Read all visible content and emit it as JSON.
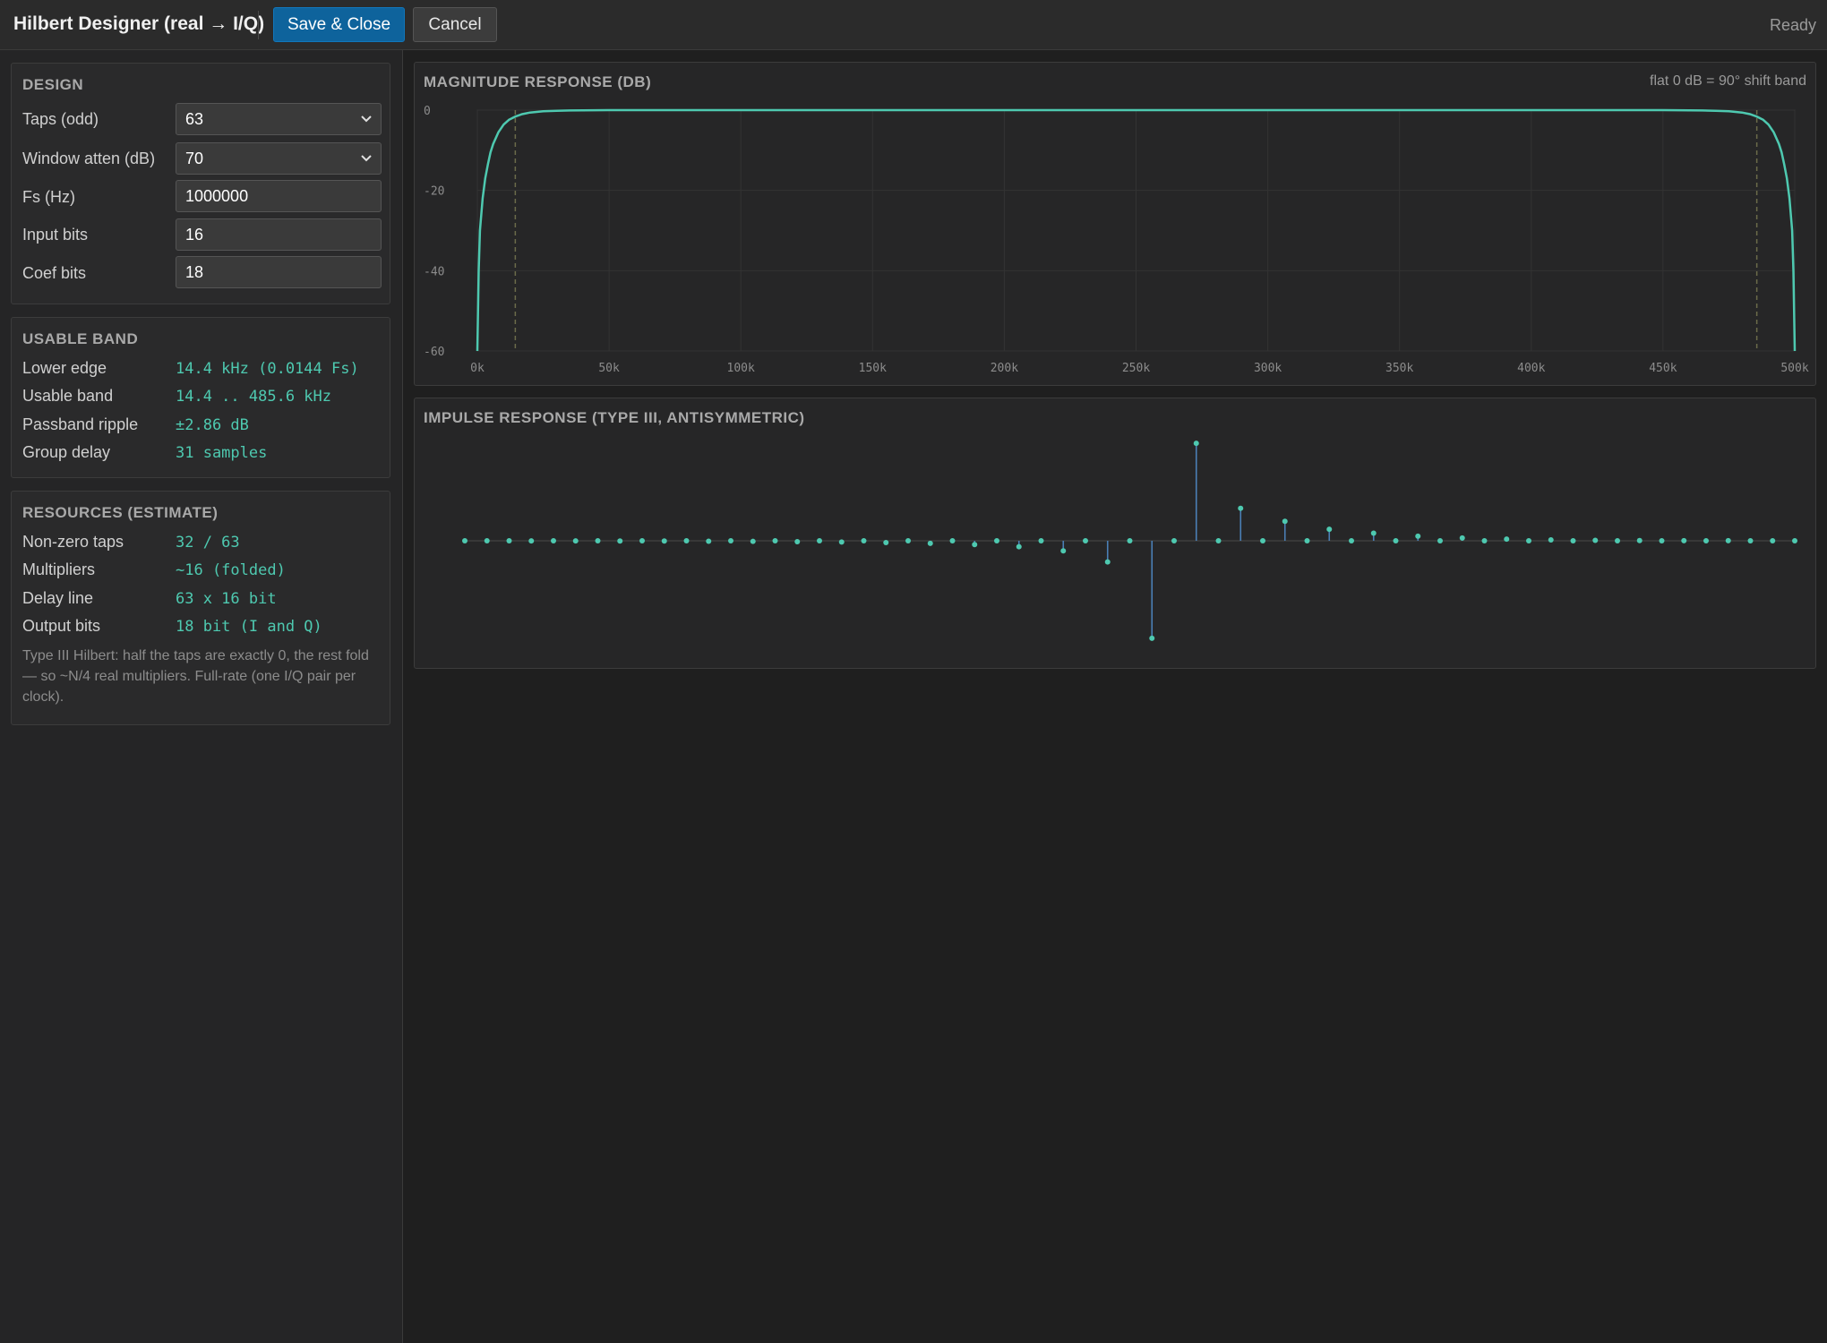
{
  "header": {
    "title": "Hilbert Designer (real → I/Q)",
    "save_label": "Save & Close",
    "cancel_label": "Cancel",
    "status": "Ready"
  },
  "design": {
    "title": "DESIGN",
    "taps_label": "Taps (odd)",
    "taps_value": "63",
    "atten_label": "Window atten (dB)",
    "atten_value": "70",
    "fs_label": "Fs (Hz)",
    "fs_value": "1000000",
    "input_bits_label": "Input bits",
    "input_bits_value": "16",
    "coef_bits_label": "Coef bits",
    "coef_bits_value": "18"
  },
  "usable_band": {
    "title": "USABLE BAND",
    "rows": [
      {
        "label": "Lower edge",
        "value": "14.4 kHz (0.0144 Fs)"
      },
      {
        "label": "Usable band",
        "value": "14.4 .. 485.6 kHz"
      },
      {
        "label": "Passband ripple",
        "value": "±2.86 dB"
      },
      {
        "label": "Group delay",
        "value": "31 samples"
      }
    ]
  },
  "resources": {
    "title": "RESOURCES (ESTIMATE)",
    "rows": [
      {
        "label": "Non-zero taps",
        "value": "32 / 63"
      },
      {
        "label": "Multipliers",
        "value": "~16 (folded)"
      },
      {
        "label": "Delay line",
        "value": "63 x 16 bit"
      },
      {
        "label": "Output bits",
        "value": "18 bit (I and Q)"
      }
    ],
    "note": "Type III Hilbert: half the taps are exactly 0, the rest fold — so ~N/4 real multipliers. Full-rate (one I/Q pair per clock)."
  },
  "colors": {
    "accent": "#4ec9b0",
    "stem": "#4a7fb5",
    "primary_button": "#0e639c",
    "marker": "#6b6b4a"
  },
  "magnitude_chart": {
    "title": "MAGNITUDE RESPONSE (DB)",
    "note": "flat 0 dB = 90° shift band",
    "chart_data": {
      "type": "line",
      "title": "MAGNITUDE RESPONSE (DB)",
      "xlim": [
        0,
        500000
      ],
      "ylim": [
        -60,
        0
      ],
      "x_ticks": [
        0,
        50000,
        100000,
        150000,
        200000,
        250000,
        300000,
        350000,
        400000,
        450000,
        500000
      ],
      "x_tick_labels": [
        "0k",
        "50k",
        "100k",
        "150k",
        "200k",
        "250k",
        "300k",
        "350k",
        "400k",
        "450k",
        "500k"
      ],
      "y_ticks": [
        0,
        -20,
        -40,
        -60
      ],
      "y_tick_labels": [
        "0",
        "-20",
        "-40",
        "-60"
      ],
      "band_edges": [
        14400,
        485600
      ],
      "grid": true,
      "series": [
        {
          "x": [
            0,
            500,
            1000,
            2000,
            3000,
            4000,
            5000,
            6000,
            8000,
            10000,
            12000,
            14400,
            17000,
            20000,
            25000,
            30000,
            35000,
            40000,
            50000,
            250000,
            450000,
            460000,
            465000,
            470000,
            475000,
            480000,
            483000,
            485600,
            488000,
            490000,
            492000,
            494000,
            495000,
            496000,
            497000,
            498000,
            499000,
            499500,
            500000
          ],
          "y": [
            -60,
            -40,
            -30,
            -22,
            -17,
            -13.5,
            -10.5,
            -8.4,
            -5.5,
            -3.6,
            -2.4,
            -1.6,
            -1.0,
            -0.6,
            -0.3,
            -0.15,
            -0.08,
            -0.04,
            0,
            0,
            0,
            -0.04,
            -0.08,
            -0.15,
            -0.3,
            -0.6,
            -1.0,
            -1.6,
            -2.4,
            -3.6,
            -5.5,
            -8.4,
            -10.5,
            -13.5,
            -17,
            -22,
            -30,
            -40,
            -60
          ]
        }
      ]
    }
  },
  "impulse_chart": {
    "title": "IMPULSE RESPONSE (TYPE III, ANTISYMMETRIC)",
    "chart_data": {
      "type": "stem",
      "title": "IMPULSE RESPONSE (TYPE III, ANTISYMMETRIC)",
      "xlim": [
        0,
        62
      ],
      "ylim": [
        -0.637,
        0.637
      ],
      "series": [
        {
          "values": [
            0,
            -0.0003,
            0,
            -0.0005,
            0,
            -0.0008,
            0,
            -0.0012,
            0,
            -0.0018,
            0,
            -0.0027,
            0,
            -0.004,
            0,
            -0.0058,
            0,
            -0.0083,
            0,
            -0.0118,
            0,
            -0.017,
            0,
            -0.025,
            0,
            -0.0385,
            0,
            -0.066,
            0,
            -0.138,
            0,
            -0.6366,
            0,
            0.6366,
            0,
            0.2122,
            0,
            0.1273,
            0,
            0.075,
            0,
            0.05,
            0,
            0.03,
            0,
            0.018,
            0,
            0.011,
            0,
            0.006,
            0,
            0.003,
            0,
            0.0015,
            0,
            0.0008,
            0,
            0.0004,
            0,
            0.0002,
            0
          ]
        }
      ]
    }
  }
}
